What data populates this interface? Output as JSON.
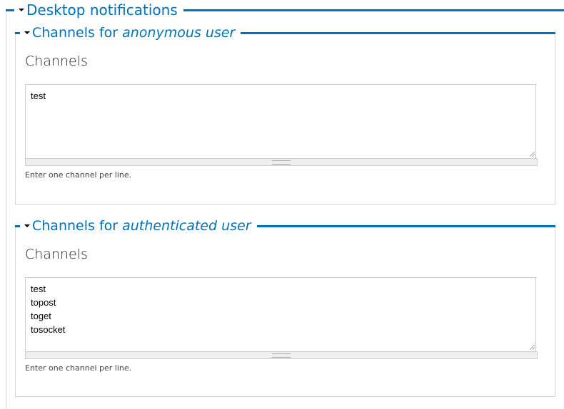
{
  "section": {
    "title": "Desktop notifications"
  },
  "fieldsets": [
    {
      "title_prefix": "Channels for ",
      "title_em": "anonymous user",
      "field_label": "Channels",
      "value": "test",
      "help": "Enter one channel per line."
    },
    {
      "title_prefix": "Channels for ",
      "title_em": "authenticated user",
      "field_label": "Channels",
      "value": "test\ntopost\ntoget\ntosocket",
      "help": "Enter one channel per line."
    }
  ],
  "colors": {
    "accent": "#0071b8"
  }
}
